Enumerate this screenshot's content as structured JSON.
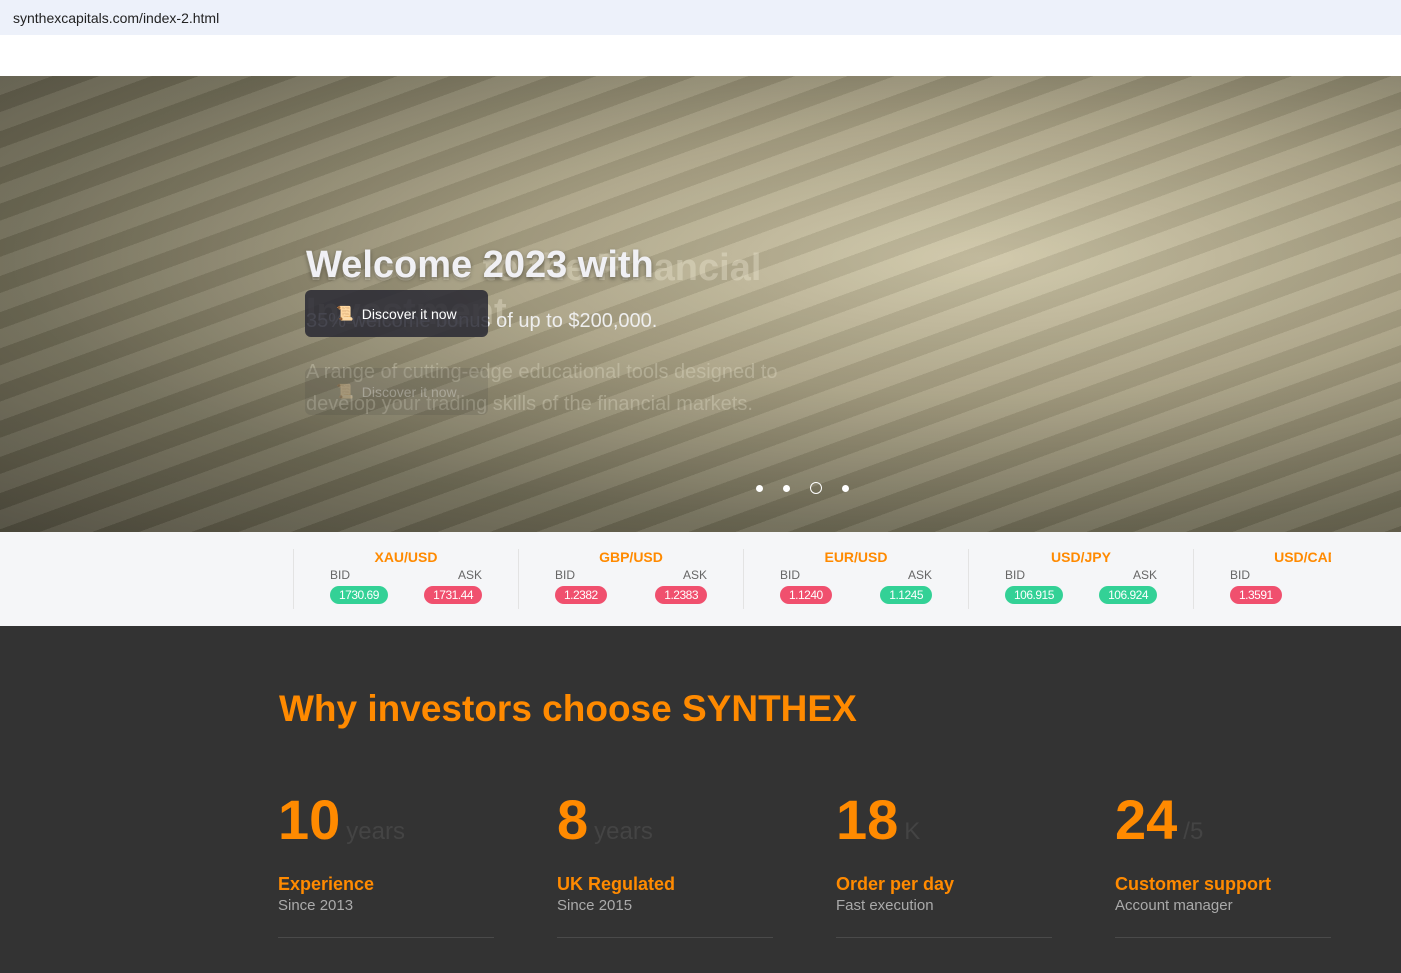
{
  "browser": {
    "url": "synthexcapitals.com/index-2.html"
  },
  "hero": {
    "title": "Welcome 2023 with",
    "subtitle": "35% welcome bonus of up to $200,000.",
    "ghost_title": "Welcome to the Financial Investment",
    "ghost_subtitle": "A range of cutting-edge educational tools designed to develop your trading skills of the financial markets.",
    "button_label": "Discover it now",
    "ghost_button_label": "Discover it now",
    "slides_count": 4,
    "active_slide": 3
  },
  "ticker": [
    {
      "pair": "XAU/USD",
      "bid_label": "BID",
      "ask_label": "ASK",
      "bid": "1730.69",
      "bid_color": "g",
      "ask": "1731.44",
      "ask_color": "r"
    },
    {
      "pair": "GBP/USD",
      "bid_label": "BID",
      "ask_label": "ASK",
      "bid": "1.2382",
      "bid_color": "r",
      "ask": "1.2383",
      "ask_color": "r"
    },
    {
      "pair": "EUR/USD",
      "bid_label": "BID",
      "ask_label": "ASK",
      "bid": "1.1240",
      "bid_color": "r",
      "ask": "1.1245",
      "ask_color": "g"
    },
    {
      "pair": "USD/JPY",
      "bid_label": "BID",
      "ask_label": "ASK",
      "bid": "106.915",
      "bid_color": "g",
      "ask": "106.924",
      "ask_color": "g"
    },
    {
      "pair": "USD/CAD",
      "bid_label": "BID",
      "ask_label": "ASK",
      "bid": "1.3591",
      "bid_color": "r",
      "ask": "",
      "ask_color": "g"
    }
  ],
  "why": {
    "title": "Why investors choose SYNTHEX",
    "stats": [
      {
        "num": "10",
        "unit": "years",
        "title": "Experience",
        "sub": "Since 2013"
      },
      {
        "num": "8",
        "unit": "years",
        "title": "UK Regulated",
        "sub": "Since 2015"
      },
      {
        "num": "18",
        "unit": "K",
        "title": "Order per day",
        "sub": "Fast execution"
      },
      {
        "num": "24",
        "unit": "/5",
        "title": "Customer support",
        "sub": "Account manager"
      }
    ]
  }
}
